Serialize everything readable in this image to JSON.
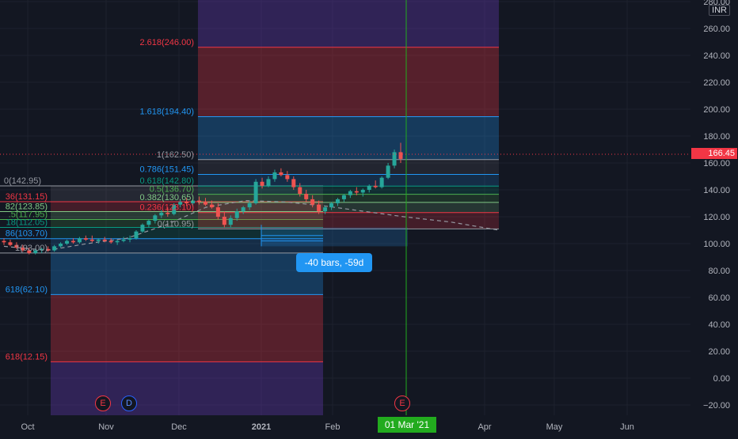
{
  "currency": "INR",
  "price_axis": {
    "ticks": [
      "280.00",
      "260.00",
      "240.00",
      "220.00",
      "200.00",
      "180.00",
      "160.00",
      "140.00",
      "120.00",
      "100.00",
      "80.00",
      "60.00",
      "40.00",
      "20.00",
      "0.00",
      "−20.00"
    ],
    "tick_values": [
      280,
      260,
      240,
      220,
      200,
      180,
      160,
      140,
      120,
      100,
      80,
      60,
      40,
      20,
      0,
      -20
    ],
    "last_price": "166.45",
    "last_price_value": 166.45,
    "last_price_color": "#f23645"
  },
  "time_axis": {
    "labels": [
      "Oct",
      "Nov",
      "Dec",
      "2021",
      "Feb",
      "Apr",
      "May",
      "Jun"
    ],
    "current_date": "01 Mar '21",
    "current_date_color": "#22ab1e"
  },
  "fib_top": {
    "levels": [
      {
        "label": "2.618(246.00)",
        "price": 246.0,
        "color": "#f23645"
      },
      {
        "label": "1.618(194.40)",
        "price": 194.4,
        "color": "#2196f3"
      },
      {
        "label": "1(162.50)",
        "price": 162.5,
        "color": "#9598a1"
      },
      {
        "label": "0.786(151.45)",
        "price": 151.45,
        "color": "#2196f3"
      },
      {
        "label": "0.618(142.80)",
        "price": 142.8,
        "color": "#089981"
      },
      {
        "label": "0.5(136.70)",
        "price": 136.7,
        "color": "#4caf50"
      },
      {
        "label": "0.382(130.65)",
        "price": 130.65,
        "color": "#81c784"
      },
      {
        "label": "0.236(123.10)",
        "price": 123.1,
        "color": "#f23645"
      },
      {
        "label": "0(110.95)",
        "price": 110.95,
        "color": "#9598a1"
      }
    ]
  },
  "fib_bottom": {
    "levels": [
      {
        "label": "0(142.95)",
        "price": 142.95,
        "color": "#9598a1"
      },
      {
        "label": "36(131.15)",
        "price": 131.15,
        "color": "#f23645"
      },
      {
        "label": "82(123.85)",
        "price": 123.85,
        "color": "#81c784"
      },
      {
        "label": ".5(117.95)",
        "price": 117.95,
        "color": "#4caf50"
      },
      {
        "label": "18(112.05)",
        "price": 112.05,
        "color": "#089981"
      },
      {
        "label": "86(103.70)",
        "price": 103.7,
        "color": "#2196f3"
      },
      {
        "label": "1(93.00)",
        "price": 93.0,
        "color": "#9598a1"
      },
      {
        "label": "618(62.10)",
        "price": 62.1,
        "color": "#2196f3"
      },
      {
        "label": "618(12.15)",
        "price": 12.15,
        "color": "#f23645"
      }
    ]
  },
  "measure_tooltip": "-40 bars, -59d",
  "events": [
    {
      "letter": "E",
      "type": "earnings"
    },
    {
      "letter": "D",
      "type": "dividend"
    },
    {
      "letter": "E",
      "type": "earnings"
    }
  ],
  "colors": {
    "background": "#131722",
    "up_candle": "#26a69a",
    "down_candle": "#ef5350",
    "cursor_line": "#22ab1e",
    "measure": "#2196f3"
  },
  "candles": [
    [
      102,
      104,
      99,
      101
    ],
    [
      101,
      103,
      98,
      99
    ],
    [
      99,
      101,
      96,
      97
    ],
    [
      97,
      99,
      94,
      95
    ],
    [
      95,
      97,
      92,
      93
    ],
    [
      93,
      96,
      92,
      95
    ],
    [
      95,
      97,
      93,
      96
    ],
    [
      96,
      98,
      94,
      95
    ],
    [
      95,
      99,
      94,
      98
    ],
    [
      98,
      101,
      97,
      100
    ],
    [
      100,
      103,
      99,
      102
    ],
    [
      102,
      104,
      100,
      101
    ],
    [
      101,
      105,
      100,
      104
    ],
    [
      104,
      106,
      102,
      103
    ],
    [
      103,
      106,
      101,
      102
    ],
    [
      102,
      104,
      100,
      103
    ],
    [
      103,
      105,
      101,
      102
    ],
    [
      102,
      104,
      100,
      101
    ],
    [
      101,
      103,
      99,
      102
    ],
    [
      102,
      105,
      101,
      103
    ],
    [
      103,
      106,
      101,
      104
    ],
    [
      104,
      110,
      103,
      109
    ],
    [
      109,
      115,
      108,
      114
    ],
    [
      114,
      118,
      112,
      117
    ],
    [
      117,
      122,
      115,
      121
    ],
    [
      121,
      125,
      119,
      123
    ],
    [
      123,
      127,
      120,
      122
    ],
    [
      122,
      130,
      121,
      129
    ],
    [
      129,
      133,
      127,
      131
    ],
    [
      131,
      134,
      128,
      130
    ],
    [
      130,
      133,
      127,
      132
    ],
    [
      132,
      135,
      129,
      131
    ],
    [
      131,
      134,
      128,
      129
    ],
    [
      129,
      132,
      126,
      127
    ],
    [
      127,
      130,
      118,
      120
    ],
    [
      120,
      124,
      112,
      114
    ],
    [
      114,
      121,
      112,
      119
    ],
    [
      119,
      126,
      117,
      124
    ],
    [
      124,
      128,
      122,
      127
    ],
    [
      127,
      132,
      125,
      130
    ],
    [
      130,
      148,
      129,
      146
    ],
    [
      146,
      149,
      141,
      143
    ],
    [
      143,
      150,
      142,
      148
    ],
    [
      148,
      155,
      146,
      153
    ],
    [
      153,
      156,
      150,
      151
    ],
    [
      151,
      154,
      146,
      148
    ],
    [
      148,
      150,
      140,
      142
    ],
    [
      142,
      145,
      135,
      137
    ],
    [
      137,
      140,
      131,
      133
    ],
    [
      133,
      136,
      127,
      129
    ],
    [
      129,
      132,
      122,
      124
    ],
    [
      124,
      128,
      122,
      127
    ],
    [
      127,
      131,
      125,
      130
    ],
    [
      130,
      134,
      128,
      133
    ],
    [
      133,
      137,
      131,
      136
    ],
    [
      136,
      140,
      134,
      139
    ],
    [
      139,
      142,
      136,
      138
    ],
    [
      138,
      141,
      135,
      140
    ],
    [
      140,
      144,
      138,
      143
    ],
    [
      143,
      147,
      141,
      142
    ],
    [
      142,
      150,
      141,
      149
    ],
    [
      149,
      160,
      148,
      158
    ],
    [
      158,
      170,
      156,
      168
    ],
    [
      168,
      175,
      160,
      163
    ]
  ]
}
